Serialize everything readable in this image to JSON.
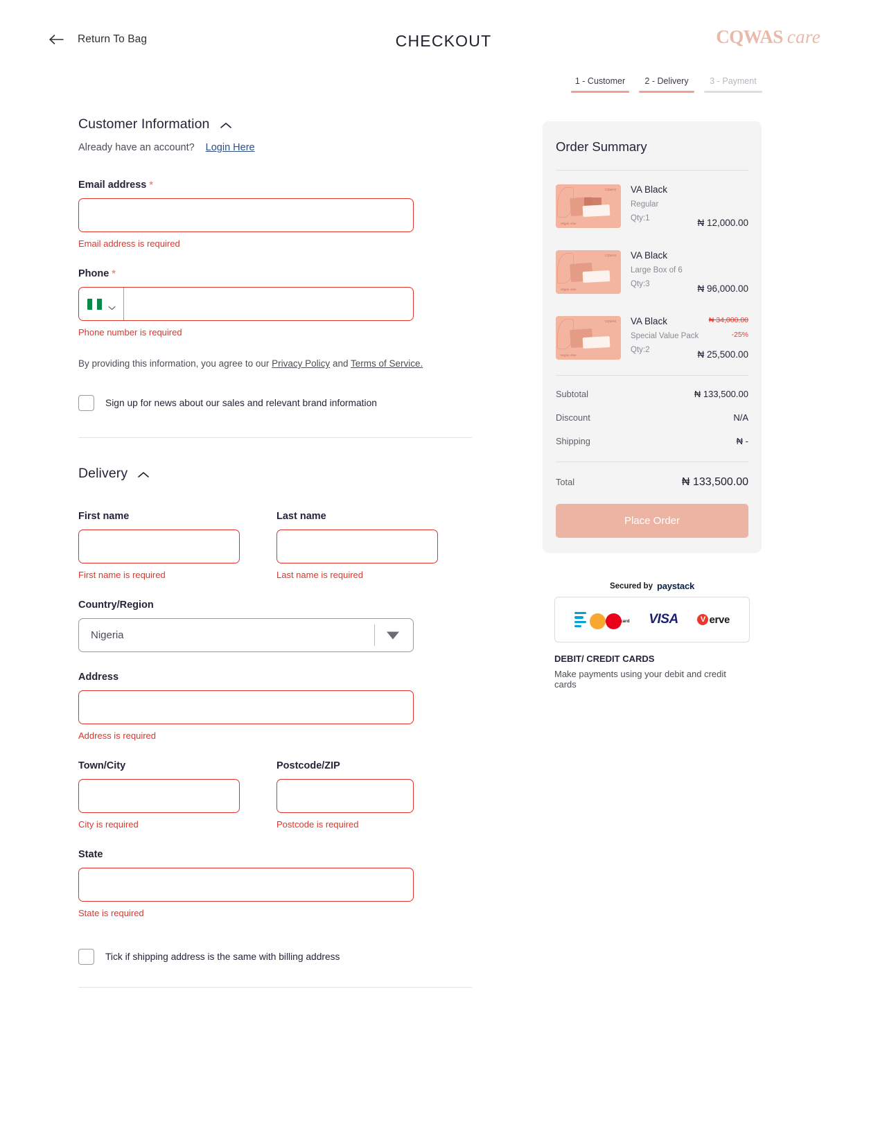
{
  "header": {
    "back_label": "Return To Bag",
    "title": "CHECKOUT",
    "brand_mark": "CQWAS",
    "brand_suffix": "care"
  },
  "steps": [
    {
      "label": "1 - Customer",
      "state": "active"
    },
    {
      "label": "2 - Delivery",
      "state": "active"
    },
    {
      "label": "3 - Payment",
      "state": "inactive"
    }
  ],
  "customer_section": {
    "title": "Customer Information",
    "account_question": "Already have an account?",
    "login_link": "Login Here",
    "email": {
      "label": "Email address",
      "required_mark": "*",
      "value": "",
      "error": "Email address is required"
    },
    "phone": {
      "label": "Phone",
      "required_mark": "*",
      "country_flag": "nigeria-flag",
      "value": "",
      "error": "Phone number is required"
    },
    "legal_prefix": "By providing this information, you agree to our ",
    "legal_privacy": "Privacy Policy",
    "legal_and": " and ",
    "legal_terms": "Terms of Service.",
    "newsletter_label": "Sign up for news about our sales and relevant brand information"
  },
  "delivery_section": {
    "title": "Delivery",
    "first_name": {
      "label": "First name",
      "value": "",
      "error": "First name is required"
    },
    "last_name": {
      "label": "Last name",
      "value": "",
      "error": "Last name is required"
    },
    "country": {
      "label": "Country/Region",
      "value": "Nigeria"
    },
    "address": {
      "label": "Address",
      "value": "",
      "error": "Address is required"
    },
    "city": {
      "label": "Town/City",
      "value": "",
      "error": "City is required"
    },
    "postcode": {
      "label": "Postcode/ZIP",
      "value": "",
      "error": "Postcode is required"
    },
    "state": {
      "label": "State",
      "value": "",
      "error": "State is required"
    },
    "same_address_label": "Tick if shipping address is the same with billing address"
  },
  "order_summary": {
    "title": "Order Summary",
    "items": [
      {
        "name": "VA Black",
        "variant": "Regular",
        "qty": "Qty:1",
        "price": "₦ 12,000.00",
        "old_price": "",
        "discount": ""
      },
      {
        "name": "VA Black",
        "variant": "Large Box of 6",
        "qty": "Qty:3",
        "price": "₦ 96,000.00",
        "old_price": "",
        "discount": ""
      },
      {
        "name": "VA Black",
        "variant": "Special Value Pack",
        "qty": "Qty:2",
        "price": "₦ 25,500.00",
        "old_price": "₦ 34,000.00",
        "discount": "-25%"
      }
    ],
    "subtotal_label": "Subtotal",
    "subtotal_value": "₦ 133,500.00",
    "discount_label": "Discount",
    "discount_value": "N/A",
    "shipping_label": "Shipping",
    "shipping_value": "₦ -",
    "total_label": "Total",
    "total_value": "₦ 133,500.00",
    "place_order_label": "Place Order"
  },
  "payment_info": {
    "secured_by": "Secured by",
    "provider": "paystack",
    "methods": [
      "bars-icon",
      "mastercard-icon",
      "visa-icon",
      "verve-icon"
    ],
    "verve_label": "erve",
    "visa_label": "VISA",
    "mastercard_label": "mastercard",
    "caption_title": "DEBIT/ CREDIT CARDS",
    "caption_text": "Make payments using your debit and credit cards"
  },
  "colors": {
    "accent": "#eeb4a3",
    "error": "#e0352b",
    "step_active": "#f0a193",
    "step_inactive": "#dedee2",
    "summary_bg": "#f4f4f5",
    "link": "#2d4f86"
  }
}
